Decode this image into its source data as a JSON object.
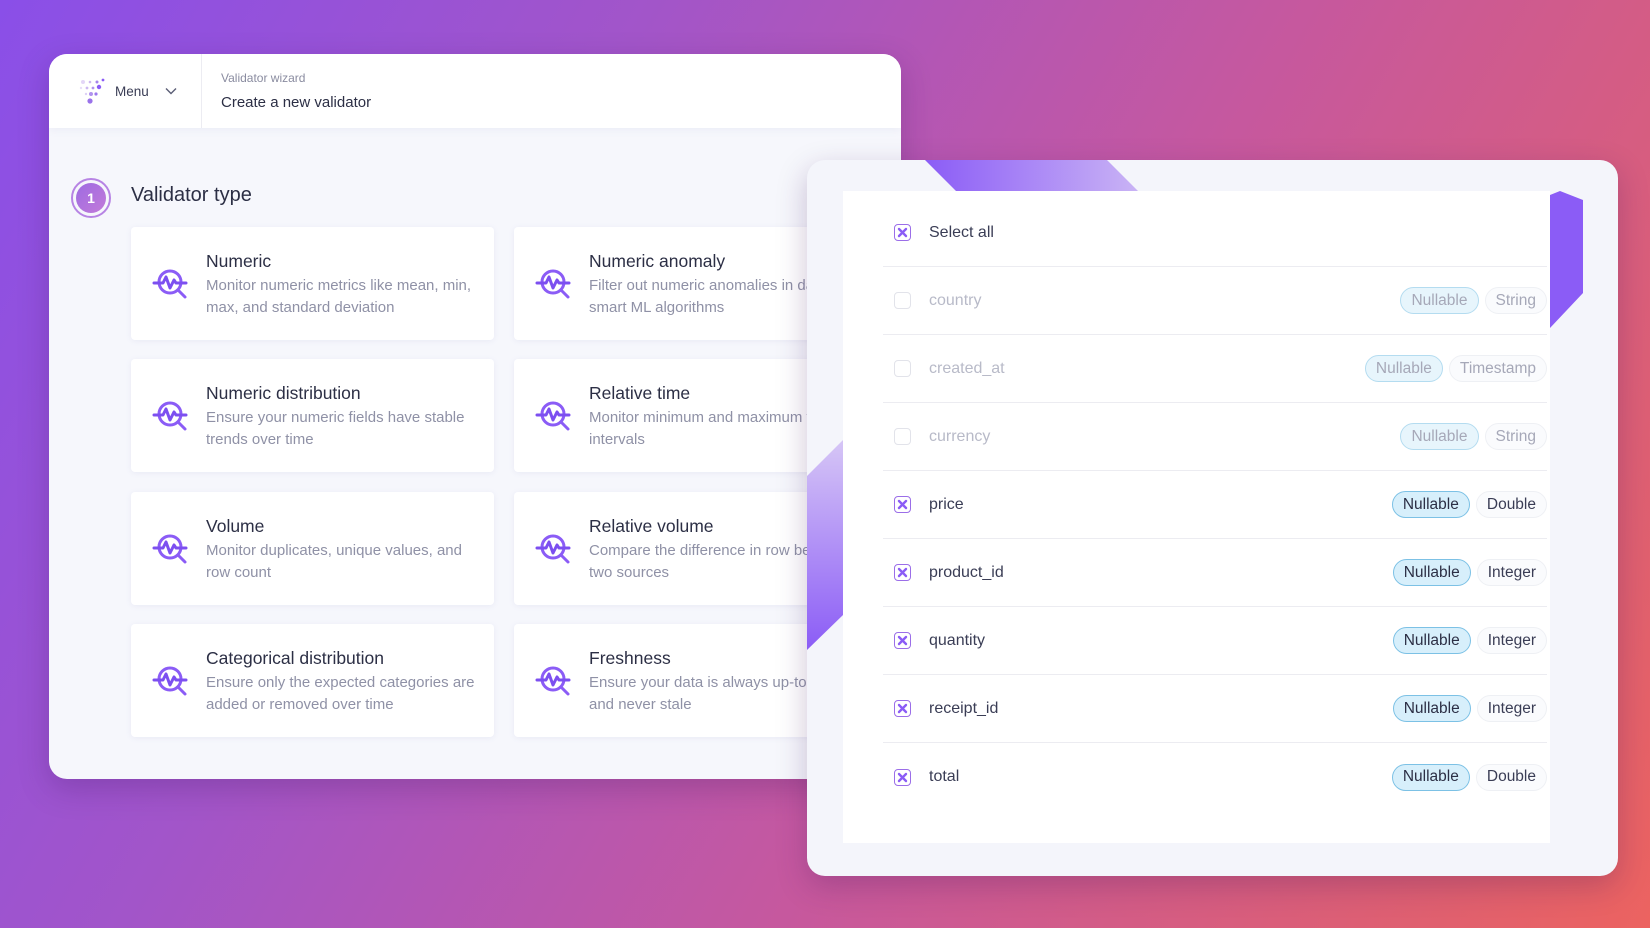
{
  "header": {
    "menu_label": "Menu",
    "breadcrumb": "Validator wizard",
    "title": "Create a new validator"
  },
  "step": {
    "number": "1",
    "title": "Validator type"
  },
  "validator_types": [
    {
      "title": "Numeric",
      "description": "Monitor numeric metrics like mean, min, max, and standard deviation",
      "icon": "monitor-search-icon"
    },
    {
      "title": "Numeric anomaly",
      "description": "Filter out numeric anomalies in data using smart ML algorithms",
      "icon": "monitor-search-icon"
    },
    {
      "title": "Numeric distribution",
      "description": "Ensure your numeric fields have stable trends over time",
      "icon": "monitor-search-icon"
    },
    {
      "title": "Relative time",
      "description": "Monitor minimum and maximum time intervals",
      "icon": "monitor-search-icon"
    },
    {
      "title": "Volume",
      "description": "Monitor duplicates, unique values, and row count",
      "icon": "monitor-search-icon"
    },
    {
      "title": "Relative volume",
      "description": "Compare the difference in row between two sources",
      "icon": "monitor-search-icon"
    },
    {
      "title": "Categorical distribution",
      "description": "Ensure only the expected categories are added or removed over time",
      "icon": "monitor-search-icon"
    },
    {
      "title": "Freshness",
      "description": "Ensure your data is always up-to-date and never stale",
      "icon": "monitor-search-icon"
    }
  ],
  "columns": {
    "select_all_label": "Select all",
    "select_all_checked": true,
    "rows": [
      {
        "name": "country",
        "nullable": "Nullable",
        "type": "String",
        "checked": false
      },
      {
        "name": "created_at",
        "nullable": "Nullable",
        "type": "Timestamp",
        "checked": false
      },
      {
        "name": "currency",
        "nullable": "Nullable",
        "type": "String",
        "checked": false
      },
      {
        "name": "price",
        "nullable": "Nullable",
        "type": "Double",
        "checked": true
      },
      {
        "name": "product_id",
        "nullable": "Nullable",
        "type": "Integer",
        "checked": true
      },
      {
        "name": "quantity",
        "nullable": "Nullable",
        "type": "Integer",
        "checked": true
      },
      {
        "name": "receipt_id",
        "nullable": "Nullable",
        "type": "Integer",
        "checked": true
      },
      {
        "name": "total",
        "nullable": "Nullable",
        "type": "Double",
        "checked": true
      }
    ]
  },
  "colors": {
    "accent": "#8b5cf6",
    "nullable_bg": "#d7effb",
    "nullable_border": "#7cc1e5"
  }
}
